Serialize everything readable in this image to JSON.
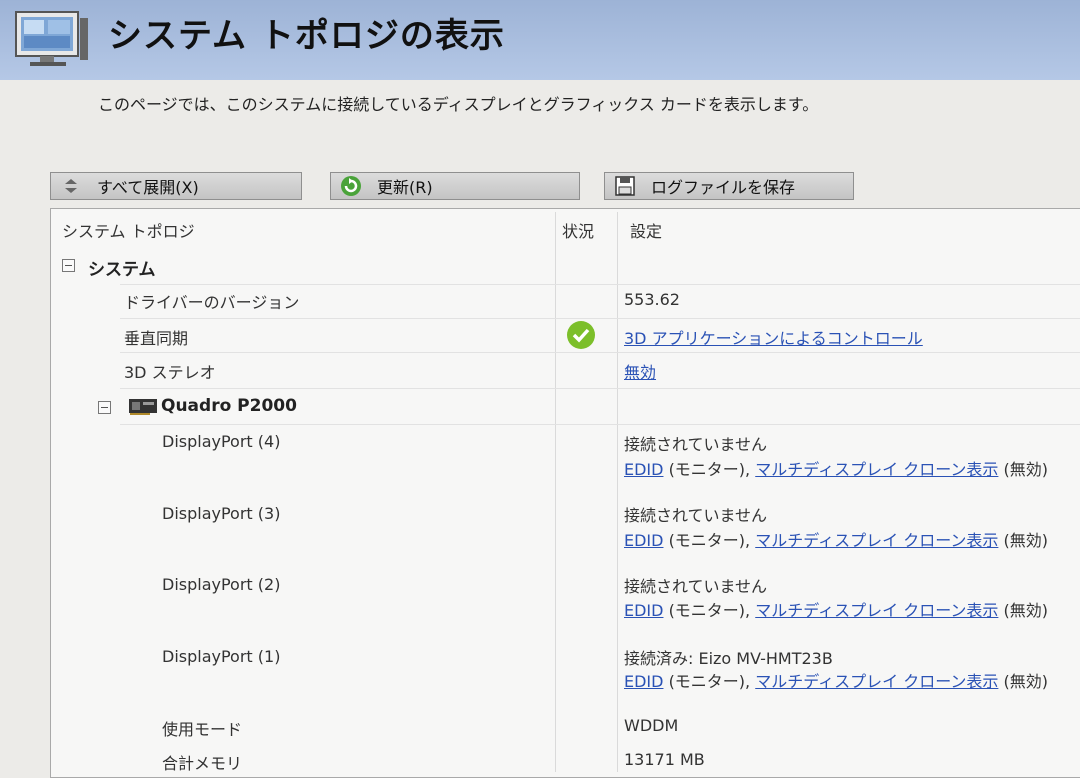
{
  "header": {
    "title": "システム トポロジの表示",
    "icon": "monitor-topology-icon"
  },
  "description": "このページでは、このシステムに接続しているディスプレイとグラフィックス カードを表示します。",
  "toolbar": {
    "expand_label": "すべて展開(X)",
    "refresh_label": "更新(R)",
    "save_label": "ログファイルを保存"
  },
  "columns": {
    "topology": "システム トポロジ",
    "status": "状況",
    "settings": "設定"
  },
  "system": {
    "label": "システム",
    "driver_label": "ドライバーのバージョン",
    "driver_value": "553.62",
    "vsync_label": "垂直同期",
    "vsync_value": "3D アプリケーションによるコントロール",
    "stereo_label": "3D ステレオ",
    "stereo_value": "無効"
  },
  "gpu": {
    "name": "Quadro P2000"
  },
  "ports": [
    {
      "name": "DisplayPort (4)",
      "status": "接続されていません"
    },
    {
      "name": "DisplayPort (3)",
      "status": "接続されていません"
    },
    {
      "name": "DisplayPort (2)",
      "status": "接続されていません"
    },
    {
      "name": "DisplayPort (1)",
      "status": "接続済み: Eizo MV-HMT23B"
    }
  ],
  "port_links": {
    "edid": "EDID",
    "monitor": "(モニター),",
    "clone": "マルチディスプレイ クローン表示",
    "disabled": "(無効)"
  },
  "usage_mode": {
    "label": "使用モード",
    "value": "WDDM"
  },
  "total_memory": {
    "label": "合計メモリ",
    "value": "13171 MB"
  },
  "colors": {
    "link": "#2a52b5",
    "header_bg": "#9db3d6"
  }
}
